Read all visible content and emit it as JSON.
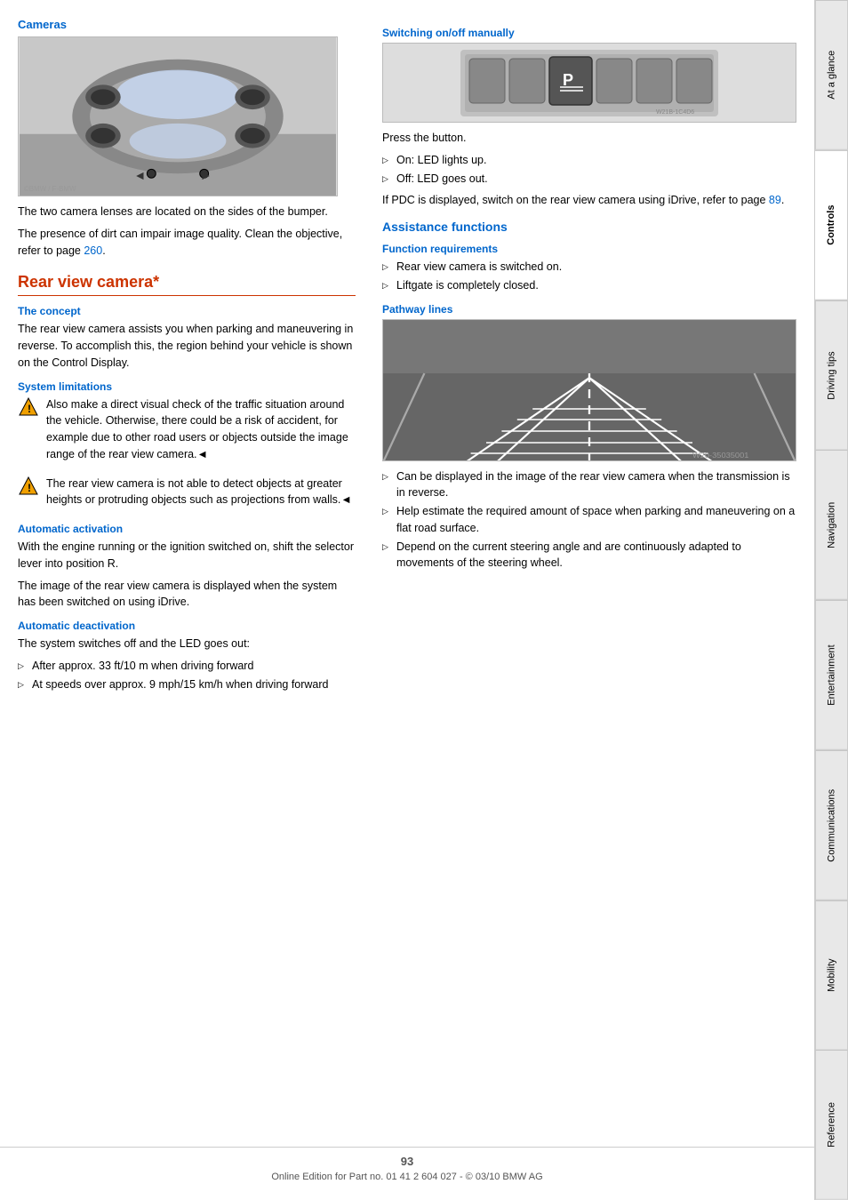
{
  "sidebar": {
    "tabs": [
      {
        "id": "at-a-glance",
        "label": "At a glance",
        "active": false
      },
      {
        "id": "controls",
        "label": "Controls",
        "active": true
      },
      {
        "id": "driving-tips",
        "label": "Driving tips",
        "active": false
      },
      {
        "id": "navigation",
        "label": "Navigation",
        "active": false
      },
      {
        "id": "entertainment",
        "label": "Entertainment",
        "active": false
      },
      {
        "id": "communications",
        "label": "Communications",
        "active": false
      },
      {
        "id": "mobility",
        "label": "Mobility",
        "active": false
      },
      {
        "id": "reference",
        "label": "Reference",
        "active": false
      }
    ]
  },
  "left_column": {
    "cameras_heading": "Cameras",
    "cameras_desc1": "The two camera lenses are located on the sides of the bumper.",
    "cameras_desc2": "The presence of dirt can impair image quality. Clean the objective, refer to page ",
    "cameras_page_link": "260",
    "cameras_page_link_suffix": ".",
    "rear_view_heading": "Rear view camera*",
    "concept_heading": "The concept",
    "concept_text": "The rear view camera assists you when parking and maneuvering in reverse. To accomplish this, the region behind your vehicle is shown on the Control Display.",
    "system_limitations_heading": "System limitations",
    "warning1_text": "Also make a direct visual check of the traffic situation around the vehicle. Otherwise, there could be a risk of accident, for example due to other road users or objects outside the image range of the rear view camera.◄",
    "warning2_text": "The rear view camera is not able to detect objects at greater heights or protruding objects such as projections from walls.◄",
    "auto_activation_heading": "Automatic activation",
    "auto_activation_text1": "With the engine running or the ignition switched on, shift the selector lever into position R.",
    "auto_activation_text2": "The image of the rear view camera is displayed when the system has been switched on using iDrive.",
    "auto_deactivation_heading": "Automatic deactivation",
    "auto_deactivation_intro": "The system switches off and the LED goes out:",
    "auto_deactivation_bullet1": "After approx. 33 ft/10 m when driving forward",
    "auto_deactivation_bullet2": "At speeds over approx. 9 mph/15 km/h when driving forward"
  },
  "right_column": {
    "switch_on_off_heading": "Switching on/off manually",
    "press_button_text": "Press the button.",
    "on_led": "On: LED lights up.",
    "off_led": "Off: LED goes out.",
    "pdc_note": "If PDC is displayed, switch on the rear view camera using iDrive, refer to page ",
    "pdc_page_link": "89",
    "pdc_page_link_suffix": ".",
    "assistance_functions_heading": "Assistance functions",
    "function_requirements_heading": "Function requirements",
    "req_bullet1": "Rear view camera is switched on.",
    "req_bullet2": "Liftgate is completely closed.",
    "pathway_lines_heading": "Pathway lines",
    "pathway_bullet1": "Can be displayed in the image of the rear view camera when the transmission is in reverse.",
    "pathway_bullet2": "Help estimate the required amount of space when parking and maneuvering on a flat road surface.",
    "pathway_bullet3": "Depend on the current steering angle and are continuously adapted to movements of the steering wheel."
  },
  "footer": {
    "page_number": "93",
    "copyright": "Online Edition for Part no. 01 41 2 604 027 - © 03/10 BMW AG"
  }
}
